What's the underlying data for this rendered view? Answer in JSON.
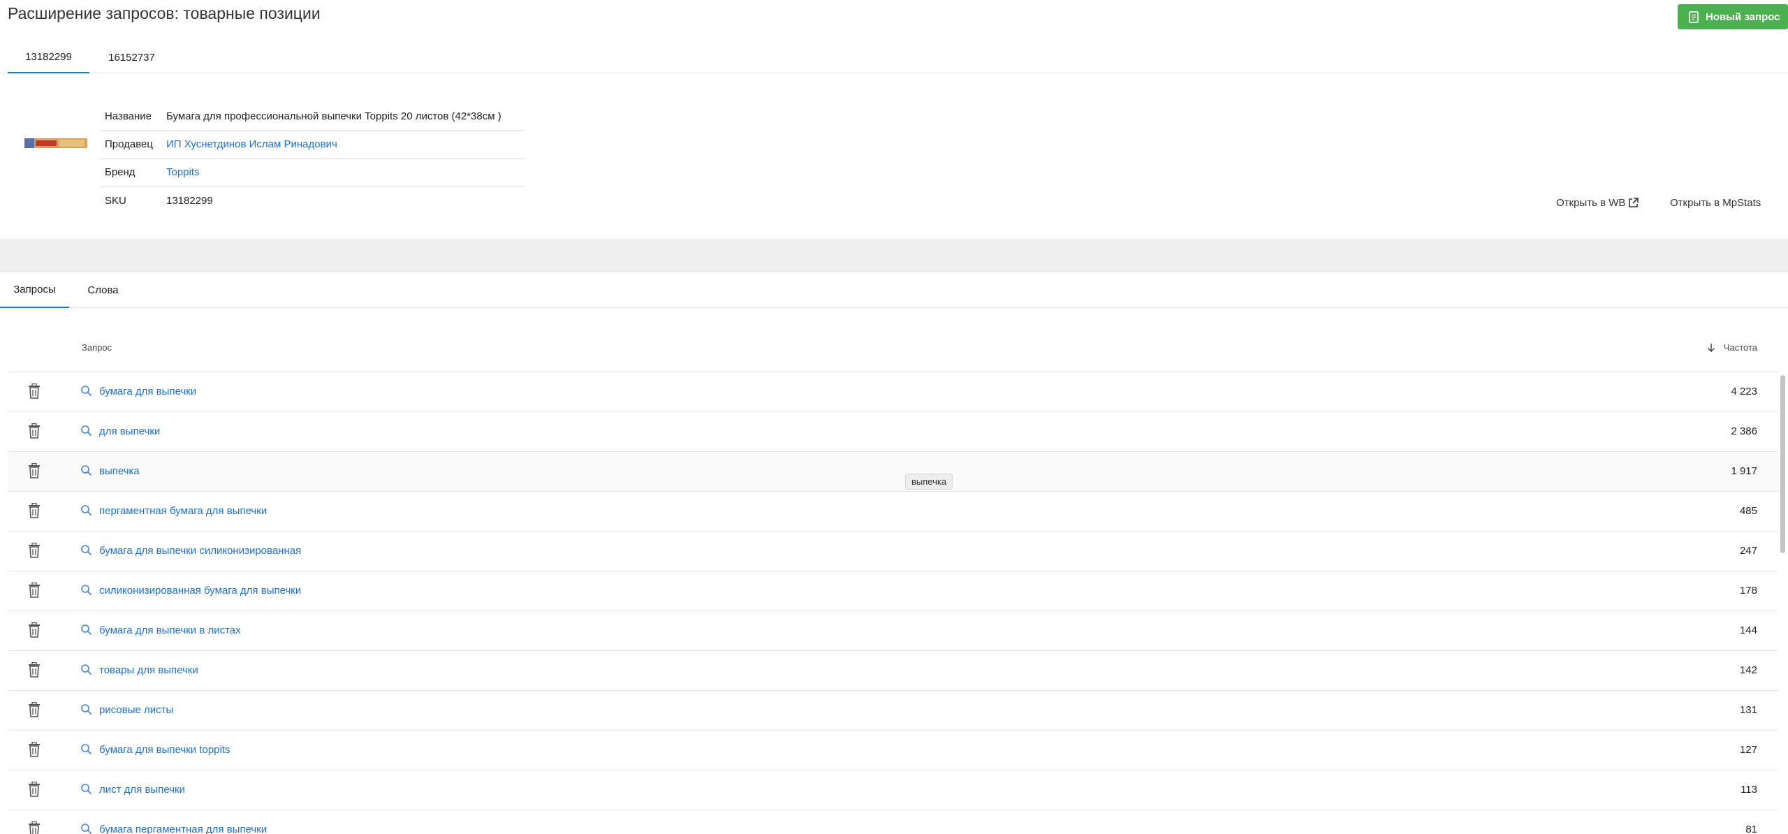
{
  "page": {
    "title": "Расширение запросов: товарные позиции",
    "new_request_label": "Новый запрос"
  },
  "sku_tabs": [
    {
      "label": "13182299",
      "active": true
    },
    {
      "label": "16152737",
      "active": false
    }
  ],
  "product": {
    "rows": [
      {
        "key": "Название",
        "value": "Бумага для профессиональной выпечки Toppits 20 листов (42*38см )",
        "link": false
      },
      {
        "key": "Продавец",
        "value": "ИП Хуснетдинов Ислам Ринадович",
        "link": true
      },
      {
        "key": "Бренд",
        "value": "Toppits",
        "link": true
      },
      {
        "key": "SKU",
        "value": "13182299",
        "link": false
      }
    ],
    "open_wb_label": "Открыть в WB",
    "open_mpstats_label": "Открыть в MpStats"
  },
  "sub_tabs": [
    {
      "label": "Запросы",
      "active": true
    },
    {
      "label": "Слова",
      "active": false
    }
  ],
  "table": {
    "col_query": "Запрос",
    "col_freq": "Частота",
    "rows": [
      {
        "query": "бумага для выпечки",
        "freq": "4 223"
      },
      {
        "query": "для выпечки",
        "freq": "2 386"
      },
      {
        "query": "выпечка",
        "freq": "1 917"
      },
      {
        "query": "пергаментная бумага для выпечки",
        "freq": "485"
      },
      {
        "query": "бумага для выпечки силиконизированная",
        "freq": "247"
      },
      {
        "query": "силиконизированная бумага для выпечки",
        "freq": "178"
      },
      {
        "query": "бумага для выпечки в листах",
        "freq": "144"
      },
      {
        "query": "товары для выпечки",
        "freq": "142"
      },
      {
        "query": "рисовые листы",
        "freq": "131"
      },
      {
        "query": "бумага для выпечки toppits",
        "freq": "127"
      },
      {
        "query": "лист для выпечки",
        "freq": "113"
      },
      {
        "query": "бумага пергаментная для выпечки",
        "freq": "81"
      }
    ]
  },
  "tooltip": {
    "text": "выпечка"
  },
  "colors": {
    "accent_green": "#4caf50",
    "link_blue": "#1e6fc9",
    "tab_underline": "#1976d2"
  },
  "icons": {
    "new_request": "document-icon",
    "trash": "trash-icon",
    "search": "search-icon",
    "external": "external-link-icon",
    "sort": "arrow-down-icon"
  }
}
